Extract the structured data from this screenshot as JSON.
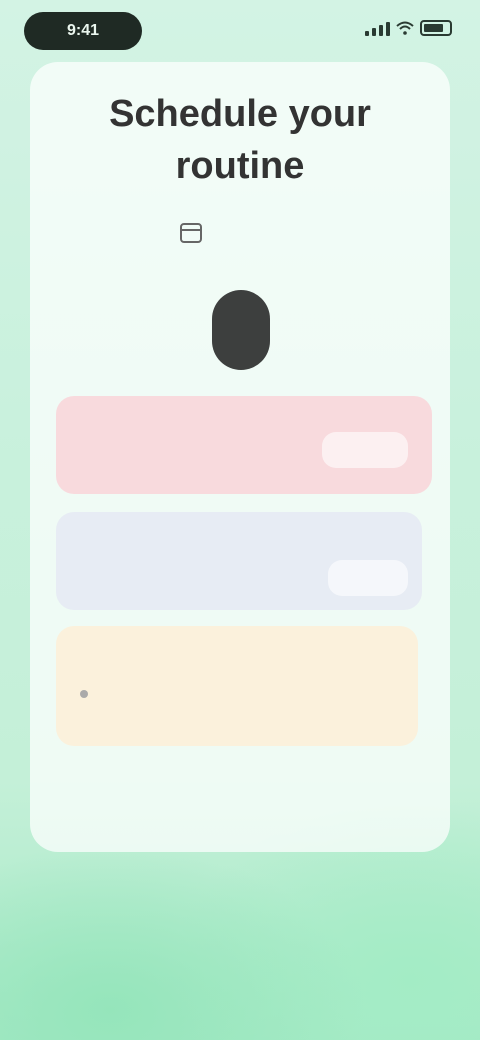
{
  "status_bar": {
    "time": "9:41"
  },
  "header": {
    "title": "Schedule your routine"
  },
  "date_row": {
    "date_label": "",
    "calendar_label": ""
  },
  "week": [
    {
      "name": "",
      "num": ""
    },
    {
      "name": "",
      "num": ""
    },
    {
      "name": "",
      "num": ""
    },
    {
      "name": "",
      "num": "",
      "selected": true
    },
    {
      "name": "",
      "num": ""
    },
    {
      "name": "",
      "num": ""
    },
    {
      "name": "",
      "num": ""
    }
  ],
  "tasks": [
    {
      "title": "",
      "time": "",
      "action": "",
      "color": "#f8dadd"
    },
    {
      "title": "",
      "time": "",
      "action": "",
      "color": "#e7ecf4"
    },
    {
      "title": "",
      "meta1": "",
      "meta2": "",
      "meta3": "",
      "color": "#fbf1dc"
    }
  ],
  "colors": {
    "accent": "#e05a5a",
    "selected_pill": "#3d3f3e",
    "background": "#c9f1dd"
  }
}
